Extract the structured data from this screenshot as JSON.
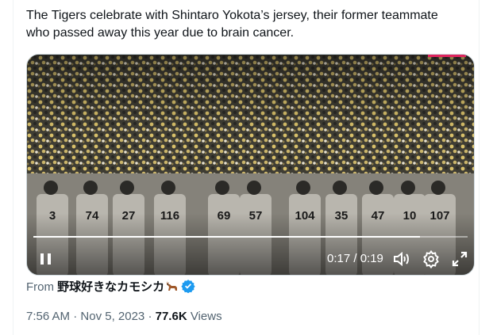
{
  "tweet": {
    "text": "The Tigers celebrate with Shintaro Yokota’s jersey, their former teammate who passed away this year due to brain cancer."
  },
  "video": {
    "elapsed": "0:17",
    "duration": "0:19",
    "time_display": "0:17 / 0:19",
    "progress_fraction": 0.89,
    "controls": [
      "pause-icon",
      "volume-icon",
      "settings-icon",
      "fullscreen-icon"
    ],
    "jersey_numbers": [
      "3",
      "74",
      "27",
      "116",
      "69",
      "57",
      "104",
      "35",
      "47",
      "10",
      "107"
    ]
  },
  "attribution": {
    "prefix": "From",
    "source": "野球好きなカモシカ",
    "emoji_icon": "deer-icon",
    "verified_icon": "verified-badge-icon"
  },
  "meta": {
    "time": "7:56 AM",
    "separator": "·",
    "date": "Nov 5, 2023",
    "views_count": "77.6K",
    "views_label": "Views"
  },
  "colors": {
    "text_primary": "#0f1419",
    "text_secondary": "#536471",
    "verified_blue": "#1d9bf0",
    "border": "#eff3f4"
  }
}
